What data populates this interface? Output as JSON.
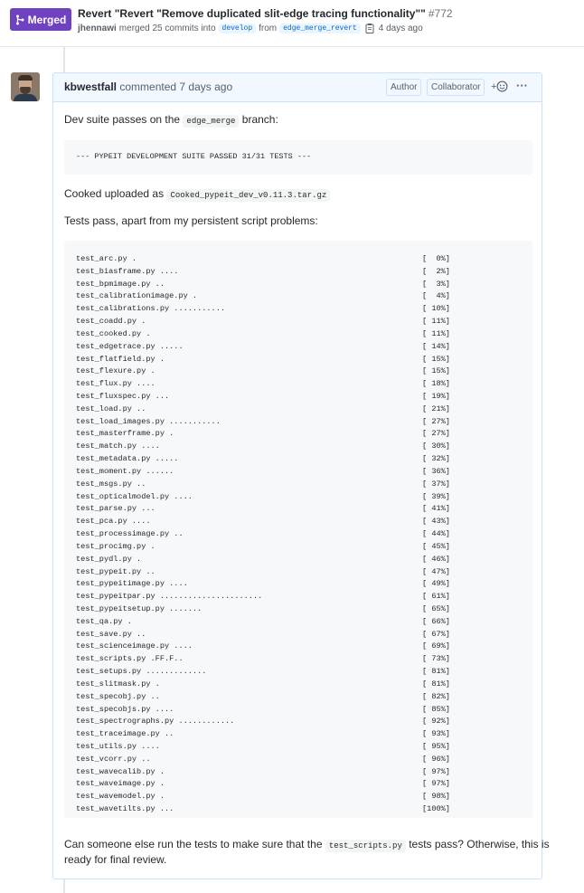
{
  "header": {
    "badge_label": "Merged",
    "title": "Revert \"Revert \"Remove duplicated slit-edge tracing functionality\"\"",
    "number": "#772",
    "author": "jhennawi",
    "merged_text": "merged 25 commits into",
    "base_branch": "develop",
    "from_text": "from",
    "head_branch": "edge_merge_revert",
    "time": "4 days ago"
  },
  "comment": {
    "user": "kbwestfall",
    "action": "commented 7 days ago",
    "labels": {
      "author": "Author",
      "collaborator": "Collaborator"
    },
    "react_symbol": "+",
    "more_symbol": "···",
    "p1_pre": "Dev suite passes on the",
    "p1_code": "edge_merge",
    "p1_post": "branch:",
    "suite_result": "--- PYPEIT DEVELOPMENT SUITE PASSED 31/31 TESTS ---",
    "p2_pre": "Cooked uploaded as",
    "p2_code": "Cooked_pypeit_dev_v0.11.3.tar.gz",
    "p3": "Tests pass, apart from my persistent script problems:",
    "tests": [
      {
        "name": "test_arc.py .",
        "pct": "[  0%]"
      },
      {
        "name": "test_biasframe.py ....",
        "pct": "[  2%]"
      },
      {
        "name": "test_bpmimage.py ..",
        "pct": "[  3%]"
      },
      {
        "name": "test_calibrationimage.py .",
        "pct": "[  4%]"
      },
      {
        "name": "test_calibrations.py ...........",
        "pct": "[ 10%]"
      },
      {
        "name": "test_coadd.py .",
        "pct": "[ 11%]"
      },
      {
        "name": "test_cooked.py .",
        "pct": "[ 11%]"
      },
      {
        "name": "test_edgetrace.py .....",
        "pct": "[ 14%]"
      },
      {
        "name": "test_flatfield.py .",
        "pct": "[ 15%]"
      },
      {
        "name": "test_flexure.py .",
        "pct": "[ 15%]"
      },
      {
        "name": "test_flux.py ....",
        "pct": "[ 18%]"
      },
      {
        "name": "test_fluxspec.py ...",
        "pct": "[ 19%]"
      },
      {
        "name": "test_load.py ..",
        "pct": "[ 21%]"
      },
      {
        "name": "test_load_images.py ...........",
        "pct": "[ 27%]"
      },
      {
        "name": "test_masterframe.py .",
        "pct": "[ 27%]"
      },
      {
        "name": "test_match.py ....",
        "pct": "[ 30%]"
      },
      {
        "name": "test_metadata.py .....",
        "pct": "[ 32%]"
      },
      {
        "name": "test_moment.py ......",
        "pct": "[ 36%]"
      },
      {
        "name": "test_msgs.py ..",
        "pct": "[ 37%]"
      },
      {
        "name": "test_opticalmodel.py ....",
        "pct": "[ 39%]"
      },
      {
        "name": "test_parse.py ...",
        "pct": "[ 41%]"
      },
      {
        "name": "test_pca.py ....",
        "pct": "[ 43%]"
      },
      {
        "name": "test_processimage.py ..",
        "pct": "[ 44%]"
      },
      {
        "name": "test_procimg.py .",
        "pct": "[ 45%]"
      },
      {
        "name": "test_pydl.py .",
        "pct": "[ 46%]"
      },
      {
        "name": "test_pypeit.py ..",
        "pct": "[ 47%]"
      },
      {
        "name": "test_pypeitimage.py ....",
        "pct": "[ 49%]"
      },
      {
        "name": "test_pypeitpar.py ......................",
        "pct": "[ 61%]"
      },
      {
        "name": "test_pypeitsetup.py .......",
        "pct": "[ 65%]"
      },
      {
        "name": "test_qa.py .",
        "pct": "[ 66%]"
      },
      {
        "name": "test_save.py ..",
        "pct": "[ 67%]"
      },
      {
        "name": "test_scienceimage.py ....",
        "pct": "[ 69%]"
      },
      {
        "name": "test_scripts.py .FF.F..",
        "pct": "[ 73%]"
      },
      {
        "name": "test_setups.py .............",
        "pct": "[ 81%]"
      },
      {
        "name": "test_slitmask.py .",
        "pct": "[ 81%]"
      },
      {
        "name": "test_specobj.py ..",
        "pct": "[ 82%]"
      },
      {
        "name": "test_specobjs.py ....",
        "pct": "[ 85%]"
      },
      {
        "name": "test_spectrographs.py ............",
        "pct": "[ 92%]"
      },
      {
        "name": "test_traceimage.py ..",
        "pct": "[ 93%]"
      },
      {
        "name": "test_utils.py ....",
        "pct": "[ 95%]"
      },
      {
        "name": "test_vcorr.py ..",
        "pct": "[ 96%]"
      },
      {
        "name": "test_wavecalib.py .",
        "pct": "[ 97%]"
      },
      {
        "name": "test_waveimage.py .",
        "pct": "[ 97%]"
      },
      {
        "name": "test_wavemodel.py .",
        "pct": "[ 98%]"
      },
      {
        "name": "test_wavetilts.py ...",
        "pct": "[100%]"
      }
    ],
    "p4_pre": "Can someone else run the tests to make sure that the",
    "p4_code": "test_scripts.py",
    "p4_post": "tests pass? Otherwise, this is",
    "p4_line2": "ready for final review."
  }
}
